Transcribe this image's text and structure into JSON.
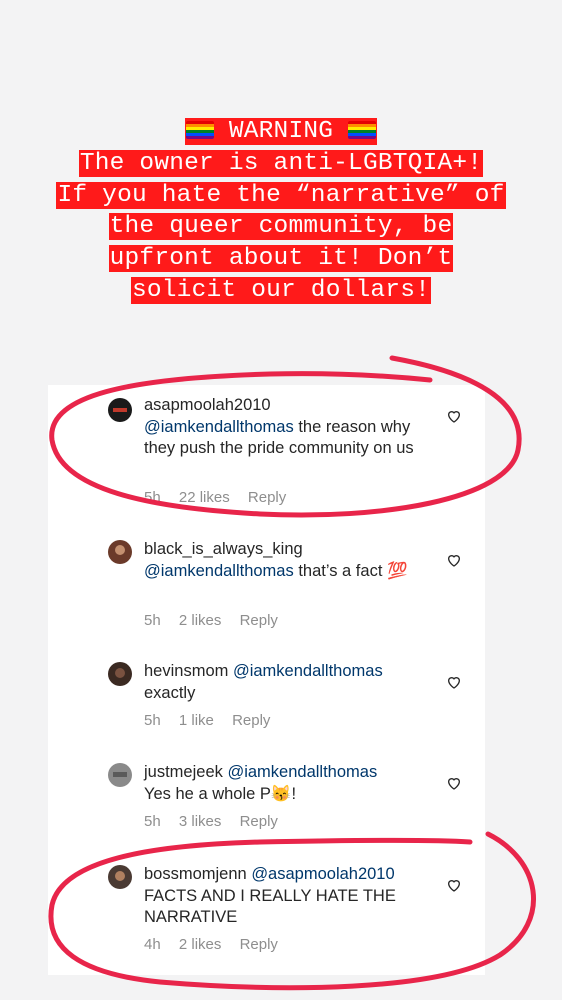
{
  "warning": {
    "line1": "WARNING",
    "line2": "The owner is anti-LGBTQIA+!",
    "line3": "If you hate the “narrative” of",
    "line4": "the queer community, be",
    "line5": "upfront about it! Don’t",
    "line6": "solicit our dollars!",
    "flag_icon": "rainbow-flag-emoji"
  },
  "comments": [
    {
      "username": "asapmoolah2010",
      "mention": "@iamkendallthomas",
      "text": " the reason why they push the pride community on us",
      "time": "5h",
      "likes": "22 likes",
      "reply": "Reply",
      "avatar_color": "#1a1a1a"
    },
    {
      "username": "black_is_always_king",
      "mention": "@iamkendallthomas",
      "text": " that’s a fact 💯",
      "time": "5h",
      "likes": "2 likes",
      "reply": "Reply",
      "avatar_color": "#6b3a2a"
    },
    {
      "username": "hevinsmom",
      "mention": "@iamkendallthomas",
      "text": "exactly",
      "time": "5h",
      "likes": "1 like",
      "reply": "Reply",
      "avatar_color": "#3b2a22"
    },
    {
      "username": "justmejeek",
      "mention": "@iamkendallthomas",
      "text": "Yes he a whole  P😽!",
      "time": "5h",
      "likes": "3 likes",
      "reply": "Reply",
      "avatar_color": "#8a8a8a"
    },
    {
      "username": "bossmomjenn",
      "mention": "@asapmoolah2010",
      "text": "FACTS AND I REALLY HATE THE NARRATIVE",
      "time": "4h",
      "likes": "2 likes",
      "reply": "Reply",
      "avatar_color": "#4a3a33"
    }
  ],
  "annotation_color": "#e8254a"
}
